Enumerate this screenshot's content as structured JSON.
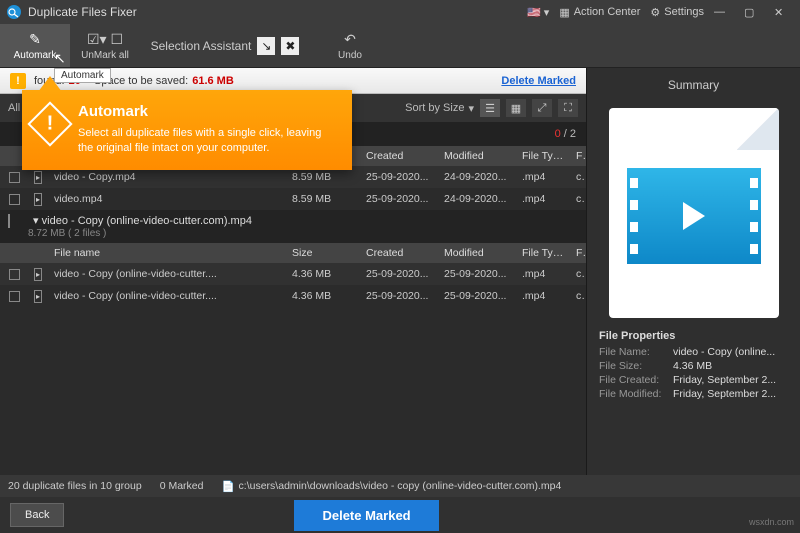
{
  "titlebar": {
    "app_name": "Duplicate Files Fixer",
    "action_center": "Action Center",
    "settings": "Settings"
  },
  "toolbar": {
    "automark": "Automark",
    "unmark_all": "UnMark all",
    "selection_assistant": "Selection Assistant",
    "undo": "Undo"
  },
  "tooltip": {
    "automark": "Automark"
  },
  "popup": {
    "title": "Automark",
    "body": "Select all duplicate files with a single click, leaving the original file intact on your computer."
  },
  "infobar": {
    "found_label": "found:",
    "found_value": "20",
    "space_label": "Space to be saved:",
    "space_value": "61.6 MB",
    "delete_marked": "Delete Marked"
  },
  "filter": {
    "all_files_label": "All fi",
    "sort_label": "Sort by Size"
  },
  "counter": {
    "selected": "0",
    "total": "2"
  },
  "columns": {
    "name": "File name",
    "size": "Size",
    "created": "Created",
    "modified": "Modified",
    "type": "File Type",
    "f": "F"
  },
  "group1_rows": [
    {
      "name": "video - Copy.mp4",
      "size": "8.59 MB",
      "created": "25-09-2020...",
      "modified": "24-09-2020...",
      "type": ".mp4",
      "f": "c"
    },
    {
      "name": "video.mp4",
      "size": "8.59 MB",
      "created": "25-09-2020...",
      "modified": "24-09-2020...",
      "type": ".mp4",
      "f": "c"
    }
  ],
  "group2": {
    "title": "video - Copy (online-video-cutter.com).mp4",
    "sub": "8.72 MB  ( 2 files )"
  },
  "group2_rows": [
    {
      "name": "video - Copy (online-video-cutter....",
      "size": "4.36 MB",
      "created": "25-09-2020...",
      "modified": "25-09-2020...",
      "type": ".mp4",
      "f": "c"
    },
    {
      "name": "video - Copy (online-video-cutter....",
      "size": "4.36 MB",
      "created": "25-09-2020...",
      "modified": "25-09-2020...",
      "type": ".mp4",
      "f": "c"
    }
  ],
  "summary": {
    "title": "Summary",
    "section": "File Properties",
    "file_name_k": "File Name:",
    "file_name_v": "video - Copy (online...",
    "file_size_k": "File Size:",
    "file_size_v": "4.36 MB",
    "file_created_k": "File Created:",
    "file_created_v": "Friday, September 2...",
    "file_modified_k": "File Modified:",
    "file_modified_v": "Friday, September 2..."
  },
  "status": {
    "count": "20 duplicate files in 10 group",
    "marked": "0 Marked",
    "path": "c:\\users\\admin\\downloads\\video - copy (online-video-cutter.com).mp4"
  },
  "footer": {
    "back": "Back",
    "delete": "Delete Marked"
  },
  "watermark": "wsxdn.com"
}
